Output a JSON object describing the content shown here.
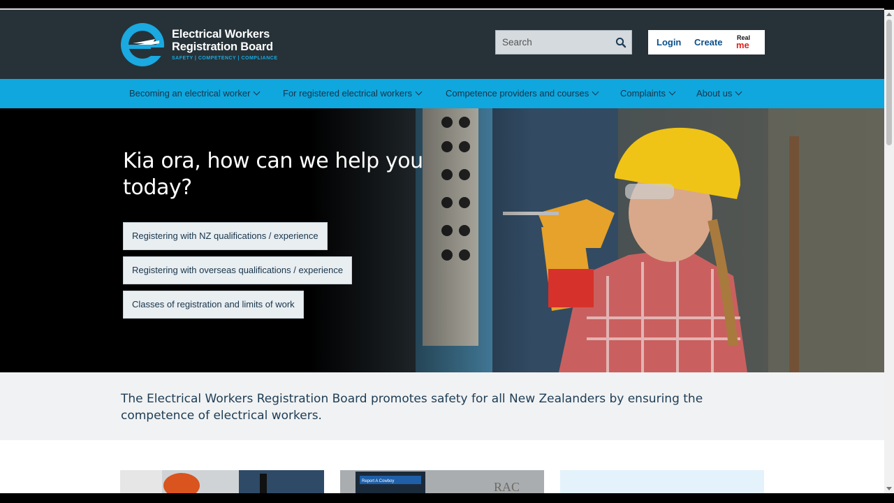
{
  "site": {
    "name_line1": "Electrical Workers",
    "name_line2": "Registration Board",
    "tagline": "SAFETY | COMPETENCY | COMPLIANCE"
  },
  "search": {
    "placeholder": "Search",
    "icon": "search-icon"
  },
  "auth": {
    "login_label": "Login",
    "create_label": "Create",
    "realme_line1": "Real",
    "realme_line2": "me"
  },
  "nav": {
    "items": [
      {
        "label": "Becoming an electrical worker"
      },
      {
        "label": "For registered electrical workers"
      },
      {
        "label": "Competence providers and courses"
      },
      {
        "label": "Complaints"
      },
      {
        "label": "About us"
      }
    ]
  },
  "hero": {
    "title": "Kia ora, how can we help you today?",
    "buttons": [
      {
        "label": "Registering with NZ qualifications / experience"
      },
      {
        "label": "Registering with overseas qualifications / experience"
      },
      {
        "label": "Classes of registration and limits of work"
      }
    ]
  },
  "intro": {
    "text": "The Electrical Workers Registration Board promotes safety for all New Zealanders by ensuring the competence of electrical workers."
  },
  "cards": [
    {
      "image": "worker-photo"
    },
    {
      "image": "report-a-cowboy-photo",
      "caption": "Report A Cowboy",
      "sign_text": "RAC"
    },
    {
      "image": "light-panel"
    }
  ],
  "colors": {
    "header_bg": "#263238",
    "nav_bg": "#0fa7de",
    "brand_blue": "#1aa9e0",
    "link_blue": "#0a4f8a",
    "text_dark": "#17344a"
  }
}
